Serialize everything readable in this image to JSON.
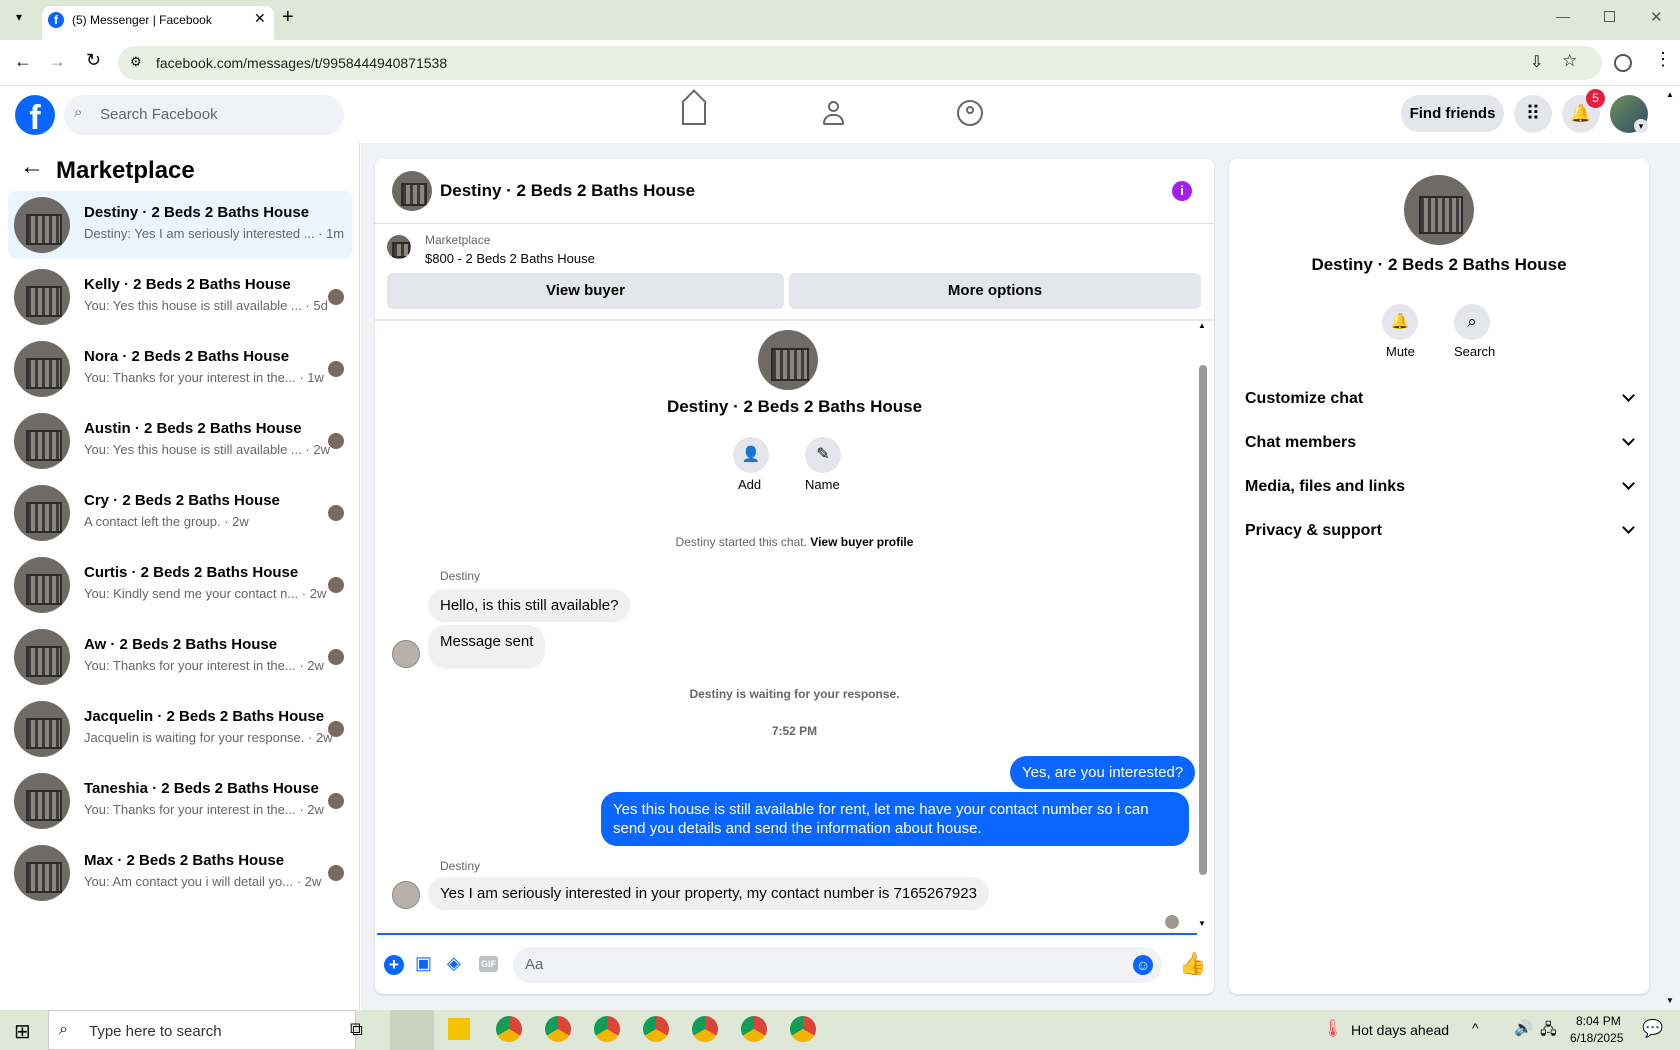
{
  "browser": {
    "tab_title": "(5) Messenger | Facebook",
    "url": "facebook.com/messages/t/9958444940871538"
  },
  "fbnav": {
    "search_placeholder": "Search Facebook",
    "find_friends": "Find friends",
    "notif_count": "5"
  },
  "left": {
    "title": "Marketplace",
    "conversations": [
      {
        "name": "Destiny · 2 Beds 2 Baths House",
        "preview": "Destiny: Yes I am seriously interested ...",
        "time": "· 1m"
      },
      {
        "name": "Kelly · 2 Beds 2 Baths House",
        "preview": "You: Yes this house is still available ...",
        "time": "· 5d"
      },
      {
        "name": "Nora · 2 Beds 2 Baths House",
        "preview": "You: Thanks for your interest in the...",
        "time": "· 1w"
      },
      {
        "name": "Austin · 2 Beds 2 Baths House",
        "preview": "You: Yes this house is still available ...",
        "time": "· 2w"
      },
      {
        "name": "Cry · 2 Beds 2 Baths House",
        "preview": "A contact left the group.",
        "time": "· 2w"
      },
      {
        "name": "Curtis · 2 Beds 2 Baths House",
        "preview": "You: Kindly send me your contact n...",
        "time": "· 2w"
      },
      {
        "name": "Aw · 2 Beds 2 Baths House",
        "preview": "You: Thanks for your interest in the...",
        "time": "· 2w"
      },
      {
        "name": "Jacquelin · 2 Beds 2 Baths House",
        "preview": "Jacquelin is waiting for your response.",
        "time": "· 2w"
      },
      {
        "name": "Taneshia · 2 Beds 2 Baths House",
        "preview": "You: Thanks for your interest in the...",
        "time": "· 2w"
      },
      {
        "name": "Max · 2 Beds 2 Baths House",
        "preview": "You: Am contact you i will detail yo...",
        "time": "· 2w"
      }
    ]
  },
  "chat": {
    "title": "Destiny · 2 Beds 2 Baths House",
    "listing_source": "Marketplace",
    "listing": "$800 - 2 Beds 2 Baths House",
    "view_buyer": "View buyer",
    "more_options": "More options",
    "profile_name": "Destiny · 2 Beds 2 Baths House",
    "add_label": "Add",
    "name_label": "Name",
    "started_text": "Destiny started this chat.",
    "view_profile": "View buyer profile",
    "sender1": "Destiny",
    "msg1": "Hello, is this still available?",
    "msg2": "Message sent",
    "waiting": "Destiny is waiting for your response.",
    "time": "7:52 PM",
    "msg3": "Yes, are you interested?",
    "msg4_line1": "Yes this house is still available for rent, let me have your contact number so i can",
    "msg4_line2": "send you details and send the information about house.",
    "sender2": "Destiny",
    "msg5": "Yes I am seriously interested in your property, my contact number is 7165267923",
    "composer_placeholder": "Aa"
  },
  "right": {
    "name": "Destiny · 2 Beds 2 Baths House",
    "mute": "Mute",
    "search": "Search",
    "sections": [
      "Customize chat",
      "Chat members",
      "Media, files and links",
      "Privacy & support"
    ]
  },
  "taskbar": {
    "search_placeholder": "Type here to search",
    "weather": "Hot days ahead",
    "time": "8:04 PM",
    "date": "6/18/2025"
  },
  "colors": {
    "accent": "#0a66ff",
    "fb_blue": "#0866ff",
    "notif": "#e41e3f"
  }
}
